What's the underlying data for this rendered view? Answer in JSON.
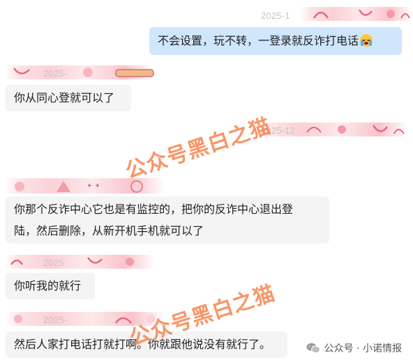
{
  "messages": [
    {
      "id": "m1",
      "side": "out",
      "timestamp": "2025-1",
      "text": "不会设置，玩不转，一登录就反诈打电话",
      "emoji": "crying-face-icon"
    },
    {
      "id": "m2",
      "side": "in",
      "timestamp": "2025-",
      "text": "你从同心登就可以了"
    },
    {
      "id": "m3",
      "side": "in",
      "timestamp": "2025-12",
      "text_line1": "你那个反诈中心它也是有监控的，把你的反诈中心退出登",
      "text_line2": "陆，然后删除，从新开机手机就可以了"
    },
    {
      "id": "m4",
      "side": "in",
      "timestamp": "2025",
      "text": "你听我的就行"
    },
    {
      "id": "m5",
      "side": "in",
      "timestamp": "2025-",
      "text": "然后人家打电话打就打啊。你就跟他说没有就行了。"
    }
  ],
  "watermark": {
    "text": "公众号黑白之猫",
    "color": "#f6783c"
  },
  "footer": {
    "text": "公众号 · 小诺情报",
    "icon": "wechat-icon"
  },
  "colors": {
    "outgoing_bubble": "#cfe6fd",
    "incoming_bubble": "#f4f4f4",
    "timestamp": "#c5c5c5"
  }
}
